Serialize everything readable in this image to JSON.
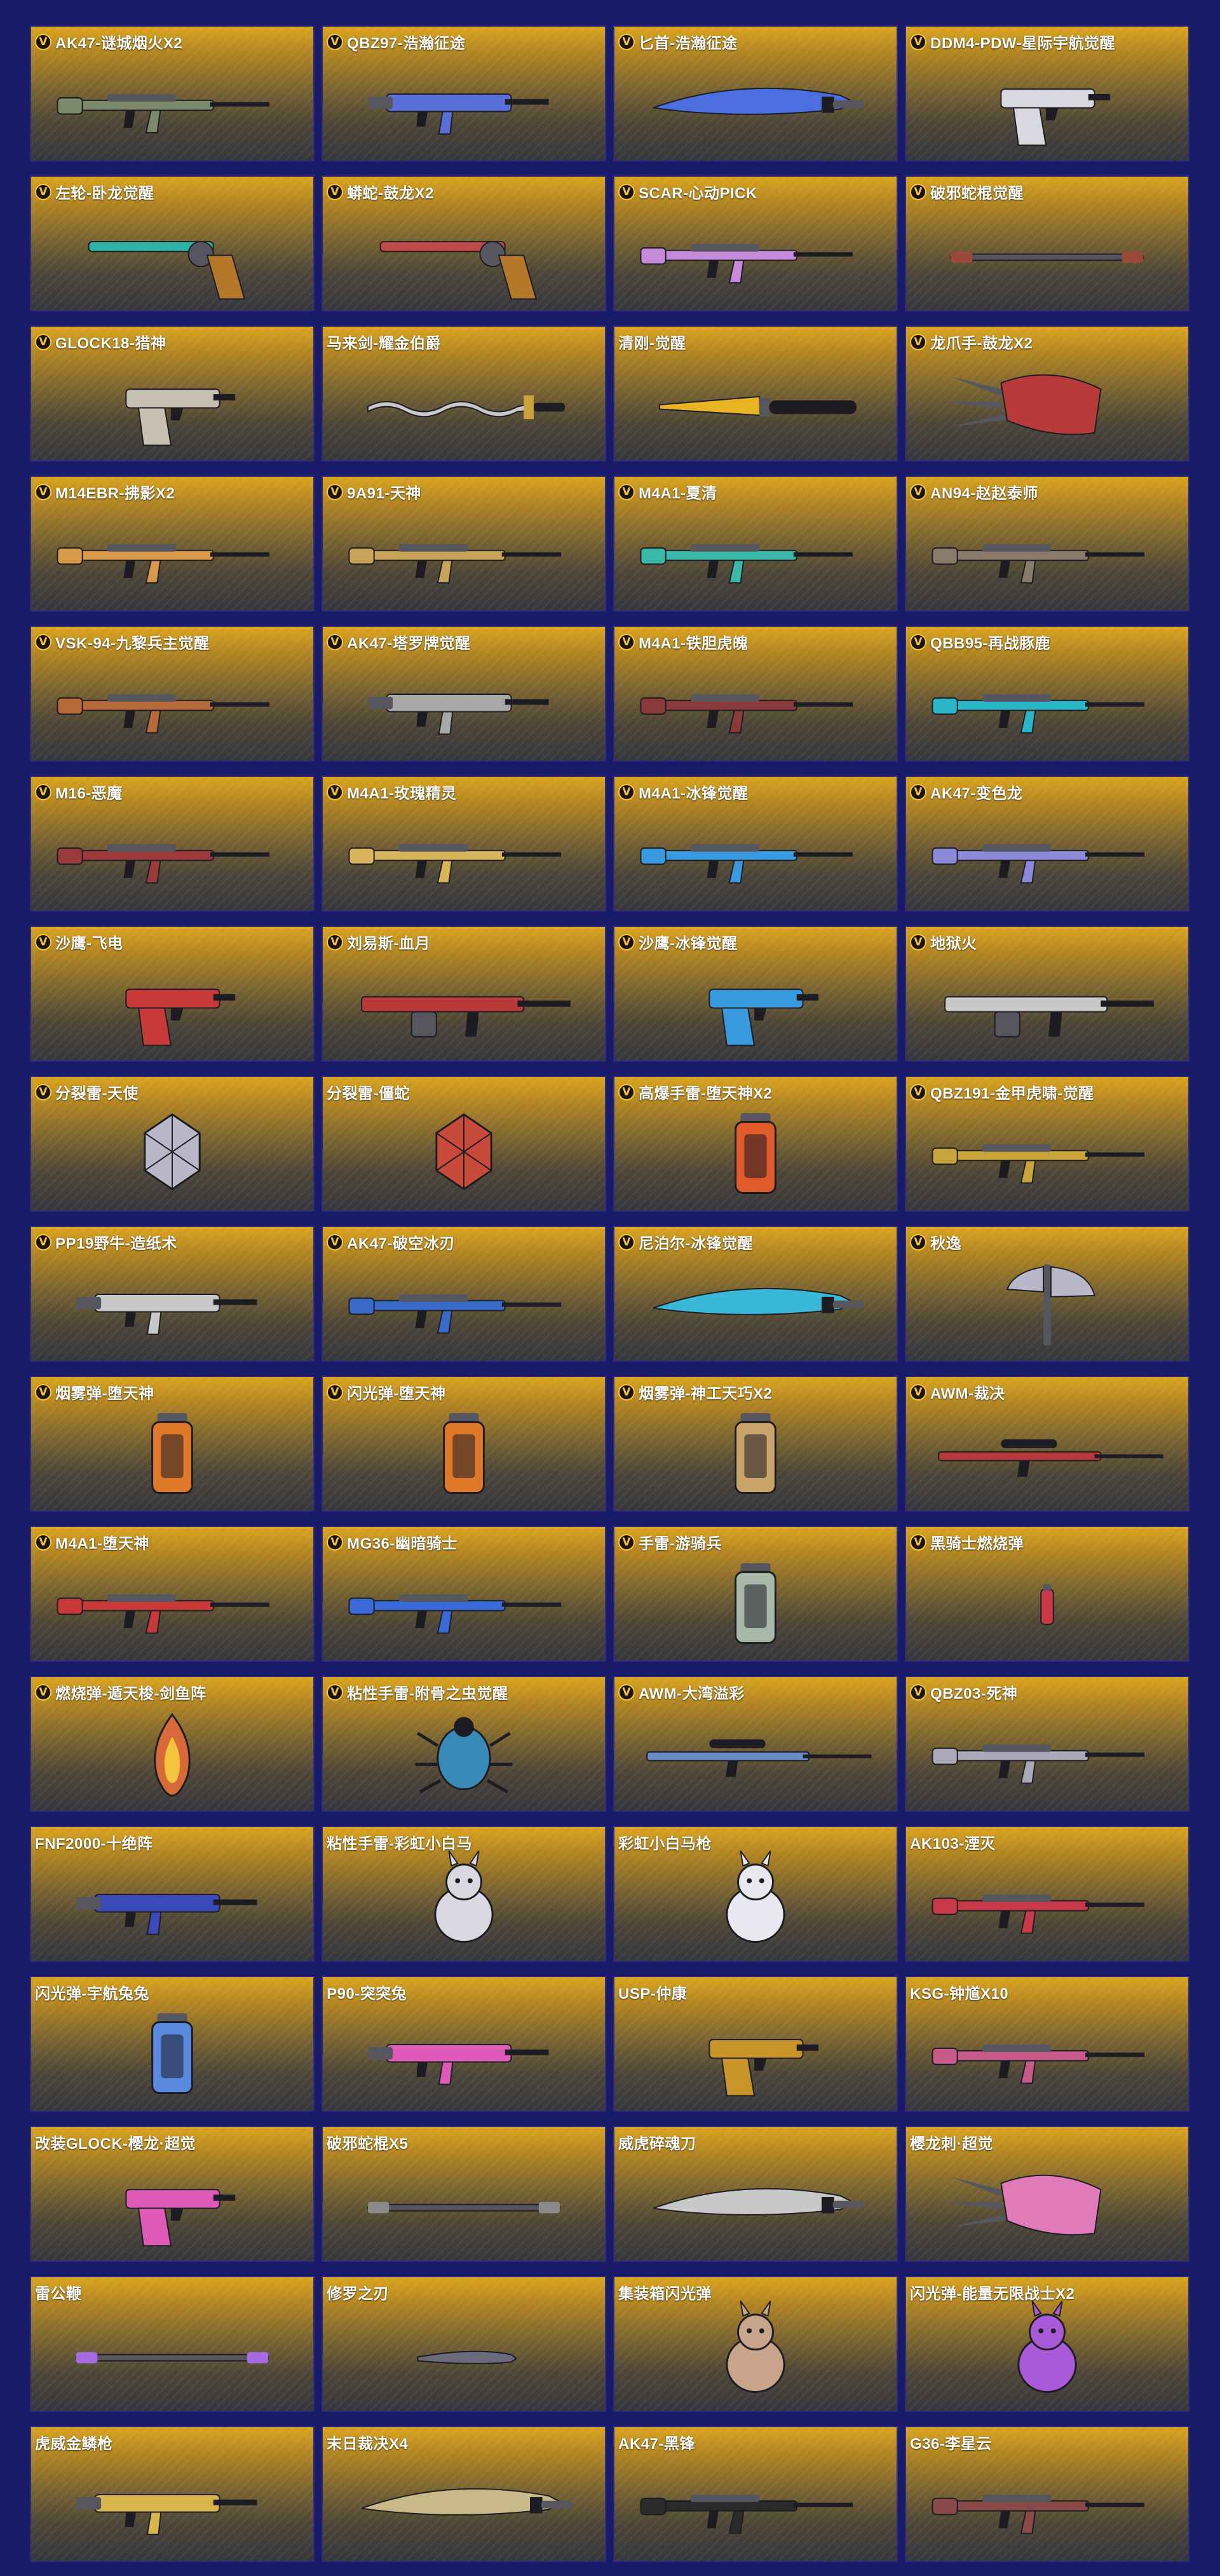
{
  "badge_label": "V",
  "items": [
    {
      "name": "AK47-谜城烟火X2",
      "badge": true,
      "art": "rifle",
      "color": "#7a8a6a"
    },
    {
      "name": "QBZ97-浩瀚征途",
      "badge": true,
      "art": "smg",
      "color": "#5b6fd8"
    },
    {
      "name": "匕首-浩瀚征途",
      "badge": true,
      "art": "blade",
      "color": "#4c6fe0"
    },
    {
      "name": "DDM4-PDW-星际宇航觉醒",
      "badge": true,
      "art": "pistol",
      "color": "#d8d8e0"
    },
    {
      "name": "左轮-卧龙觉醒",
      "badge": true,
      "art": "revolver",
      "color": "#2bb3a6"
    },
    {
      "name": "蟒蛇-鼓龙X2",
      "badge": true,
      "art": "revolver",
      "color": "#c24848"
    },
    {
      "name": "SCAR-心动PICK",
      "badge": true,
      "art": "rifle",
      "color": "#c58ad8"
    },
    {
      "name": "破邪蛇棍觉醒",
      "badge": true,
      "art": "staff",
      "color": "#9a4a3a"
    },
    {
      "name": "GLOCK18-猎神",
      "badge": true,
      "art": "pistol",
      "color": "#c8c0b0"
    },
    {
      "name": "马来剑-耀金伯爵",
      "badge": false,
      "art": "wavy",
      "color": "#c8c8c8"
    },
    {
      "name": "清刚-觉醒",
      "badge": false,
      "art": "knife",
      "color": "#e8b422"
    },
    {
      "name": "龙爪手-鼓龙X2",
      "badge": true,
      "art": "claw",
      "color": "#b83a3a"
    },
    {
      "name": "M14EBR-拂影X2",
      "badge": true,
      "art": "rifle",
      "color": "#d89a4a"
    },
    {
      "name": "9A91-天神",
      "badge": true,
      "art": "rifle",
      "color": "#c8a45a"
    },
    {
      "name": "M4A1-夏清",
      "badge": true,
      "art": "rifle",
      "color": "#3ab8a8"
    },
    {
      "name": "AN94-赵赵泰师",
      "badge": true,
      "art": "rifle",
      "color": "#8a7a6a"
    },
    {
      "name": "VSK-94-九黎兵主觉醒",
      "badge": true,
      "art": "rifle",
      "color": "#b86a3a"
    },
    {
      "name": "AK47-塔罗牌觉醒",
      "badge": true,
      "art": "smg",
      "color": "#a8a8a8"
    },
    {
      "name": "M4A1-铁胆虎魄",
      "badge": true,
      "art": "rifle",
      "color": "#8a3a3a"
    },
    {
      "name": "QBB95-再战豚鹿",
      "badge": true,
      "art": "rifle",
      "color": "#2ab8c8"
    },
    {
      "name": "M16-恶魔",
      "badge": true,
      "art": "rifle",
      "color": "#9a3a3a"
    },
    {
      "name": "M4A1-玫瑰精灵",
      "badge": true,
      "art": "rifle",
      "color": "#d8b45a"
    },
    {
      "name": "M4A1-冰锋觉醒",
      "badge": true,
      "art": "rifle",
      "color": "#3a9ae0"
    },
    {
      "name": "AK47-变色龙",
      "badge": true,
      "art": "rifle",
      "color": "#8a8ad8"
    },
    {
      "name": "沙鹰-飞电",
      "badge": true,
      "art": "pistol",
      "color": "#c83a3a"
    },
    {
      "name": "刘易斯-血月",
      "badge": true,
      "art": "lmg",
      "color": "#b83a3a"
    },
    {
      "name": "沙鹰-冰锋觉醒",
      "badge": true,
      "art": "pistol",
      "color": "#3a9ae0"
    },
    {
      "name": "地狱火",
      "badge": true,
      "art": "lmg",
      "color": "#c8c8c8"
    },
    {
      "name": "分裂雷-天使",
      "badge": true,
      "art": "grenade",
      "color": "#b8b8c8"
    },
    {
      "name": "分裂雷-僵蛇",
      "badge": false,
      "art": "grenade",
      "color": "#c84a3a"
    },
    {
      "name": "高爆手雷-堕天神X2",
      "badge": true,
      "art": "canister",
      "color": "#e05a2a"
    },
    {
      "name": "QBZ191-金甲虎啸-觉醒",
      "badge": true,
      "art": "rifle",
      "color": "#c8a43a"
    },
    {
      "name": "PP19野牛-造纸术",
      "badge": true,
      "art": "smg",
      "color": "#c8c8c8"
    },
    {
      "name": "AK47-破空冰刃",
      "badge": true,
      "art": "rifle",
      "color": "#3a6ac8"
    },
    {
      "name": "尼泊尔-冰锋觉醒",
      "badge": true,
      "art": "blade",
      "color": "#3ab8d8"
    },
    {
      "name": "秋逸",
      "badge": true,
      "art": "axe",
      "color": "#b8b8c8"
    },
    {
      "name": "烟雾弹-堕天神",
      "badge": true,
      "art": "canister",
      "color": "#e0782a"
    },
    {
      "name": "闪光弹-堕天神",
      "badge": true,
      "art": "canister",
      "color": "#e0782a"
    },
    {
      "name": "烟雾弹-神工天巧X2",
      "badge": true,
      "art": "canister",
      "color": "#c8a46a"
    },
    {
      "name": "AWM-裁决",
      "badge": true,
      "art": "sniper",
      "color": "#b83a3a"
    },
    {
      "name": "M4A1-堕天神",
      "badge": true,
      "art": "rifle",
      "color": "#c83a3a"
    },
    {
      "name": "MG36-幽暗骑士",
      "badge": true,
      "art": "rifle",
      "color": "#3a6ad8"
    },
    {
      "name": "手雷-游骑兵",
      "badge": true,
      "art": "canister",
      "color": "#a8b8a8"
    },
    {
      "name": "黑骑士燃烧弹",
      "badge": true,
      "art": "small",
      "color": "#c83a4a"
    },
    {
      "name": "燃烧弹-遁天梭-剑鱼阵",
      "badge": true,
      "art": "flame",
      "color": "#d86a3a"
    },
    {
      "name": "粘性手雷-附骨之虫觉醒",
      "badge": true,
      "art": "bug",
      "color": "#3a8ab8"
    },
    {
      "name": "AWM-大湾溢彩",
      "badge": true,
      "art": "sniper",
      "color": "#6a8ac8"
    },
    {
      "name": "QBZ03-死神",
      "badge": true,
      "art": "rifle",
      "color": "#a8a8b8"
    },
    {
      "name": "FNF2000-十绝阵",
      "badge": false,
      "art": "smg",
      "color": "#3a4ab8"
    },
    {
      "name": "粘性手雷-彩虹小白马",
      "badge": false,
      "art": "toy",
      "color": "#d8d8e0"
    },
    {
      "name": "彩虹小白马枪",
      "badge": false,
      "art": "toy",
      "color": "#e8e8f0"
    },
    {
      "name": "AK103-湮灭",
      "badge": false,
      "art": "rifle",
      "color": "#c83a4a"
    },
    {
      "name": "闪光弹-宇航兔兔",
      "badge": false,
      "art": "canister",
      "color": "#5a8ae0"
    },
    {
      "name": "P90-突突兔",
      "badge": false,
      "art": "smg",
      "color": "#e05ab8"
    },
    {
      "name": "USP-仲康",
      "badge": false,
      "art": "pistol",
      "color": "#c8942a"
    },
    {
      "name": "KSG-钟馗X10",
      "badge": false,
      "art": "rifle",
      "color": "#c85a8a"
    },
    {
      "name": "改装GLOCK-樱龙·超觉",
      "badge": false,
      "art": "pistol",
      "color": "#e05ab8"
    },
    {
      "name": "破邪蛇棍X5",
      "badge": false,
      "art": "staff",
      "color": "#8a8a8a"
    },
    {
      "name": "威虎碎魂刀",
      "badge": false,
      "art": "blade",
      "color": "#c8c8c8"
    },
    {
      "name": "樱龙刺·超觉",
      "badge": false,
      "art": "claw",
      "color": "#e07ab8"
    },
    {
      "name": "雷公鞭",
      "badge": false,
      "art": "staff",
      "color": "#a86ae0"
    },
    {
      "name": "修罗之刃",
      "badge": false,
      "art": "small-blade",
      "color": "#6a6a7a"
    },
    {
      "name": "集装箱闪光弹",
      "badge": false,
      "art": "toy",
      "color": "#c8a48a"
    },
    {
      "name": "闪光弹-能量无限战士X2",
      "badge": false,
      "art": "toy",
      "color": "#a85ad8"
    },
    {
      "name": "虎威金鳞枪",
      "badge": false,
      "art": "smg",
      "color": "#d8b44a"
    },
    {
      "name": "末日裁决X4",
      "badge": false,
      "art": "blade",
      "color": "#c8b88a"
    },
    {
      "name": "AK47-黑锋",
      "badge": false,
      "art": "rifle",
      "color": "#2a2a2a"
    },
    {
      "name": "G36-李星云",
      "badge": false,
      "art": "rifle",
      "color": "#8a4a4a"
    }
  ]
}
